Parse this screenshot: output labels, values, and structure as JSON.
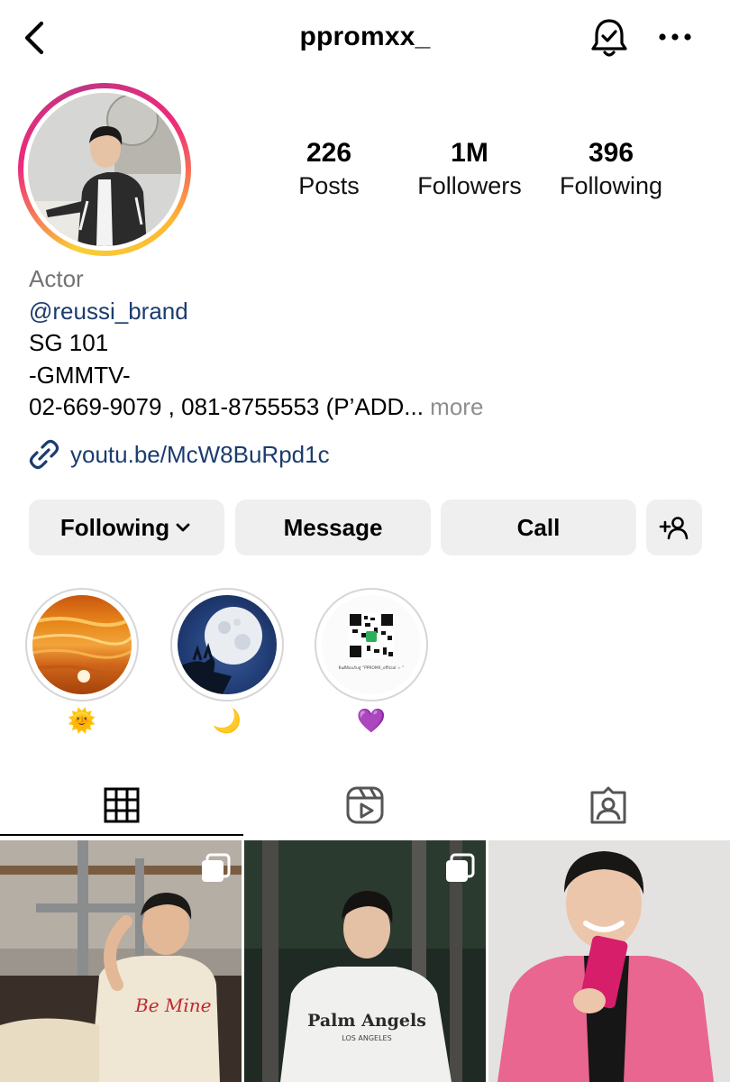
{
  "header": {
    "username": "ppromxx_",
    "back_icon": "chevron-left-icon",
    "bell_icon": "bell-check-icon",
    "more_icon": "more-horizontal-icon"
  },
  "stats": [
    {
      "value": "226",
      "label": "Posts"
    },
    {
      "value": "1M",
      "label": "Followers"
    },
    {
      "value": "396",
      "label": "Following"
    }
  ],
  "bio": {
    "category": "Actor",
    "mention": "@reussi_brand",
    "lines": [
      "SG 101",
      "-GMMTV-"
    ],
    "phone_line": "02-669-9079 , 081-8755553 (P’ADD...",
    "more": " more",
    "link": "youtu.be/McW8BuRpd1c"
  },
  "buttons": {
    "following": "Following",
    "message": "Message",
    "call": "Call"
  },
  "highlights": [
    {
      "label": "🌞"
    },
    {
      "label": "🌙"
    },
    {
      "label": "💜"
    }
  ],
  "highlight_qr_caption": "ยินดีต้อนรับสู่ “PPROMX_official ☆ ”",
  "tabs": [
    "grid-icon",
    "reels-icon",
    "tagged-icon"
  ],
  "posts": [
    {
      "shirt_text": "Be Mine",
      "multi": true
    },
    {
      "shirt_text": "Palm Angels",
      "shirt_subtext": "LOS ANGELES",
      "multi": true
    },
    {
      "multi": false
    }
  ],
  "colors": {
    "link": "#1b3c6e",
    "button_bg": "#efefef",
    "muted": "#737373"
  }
}
